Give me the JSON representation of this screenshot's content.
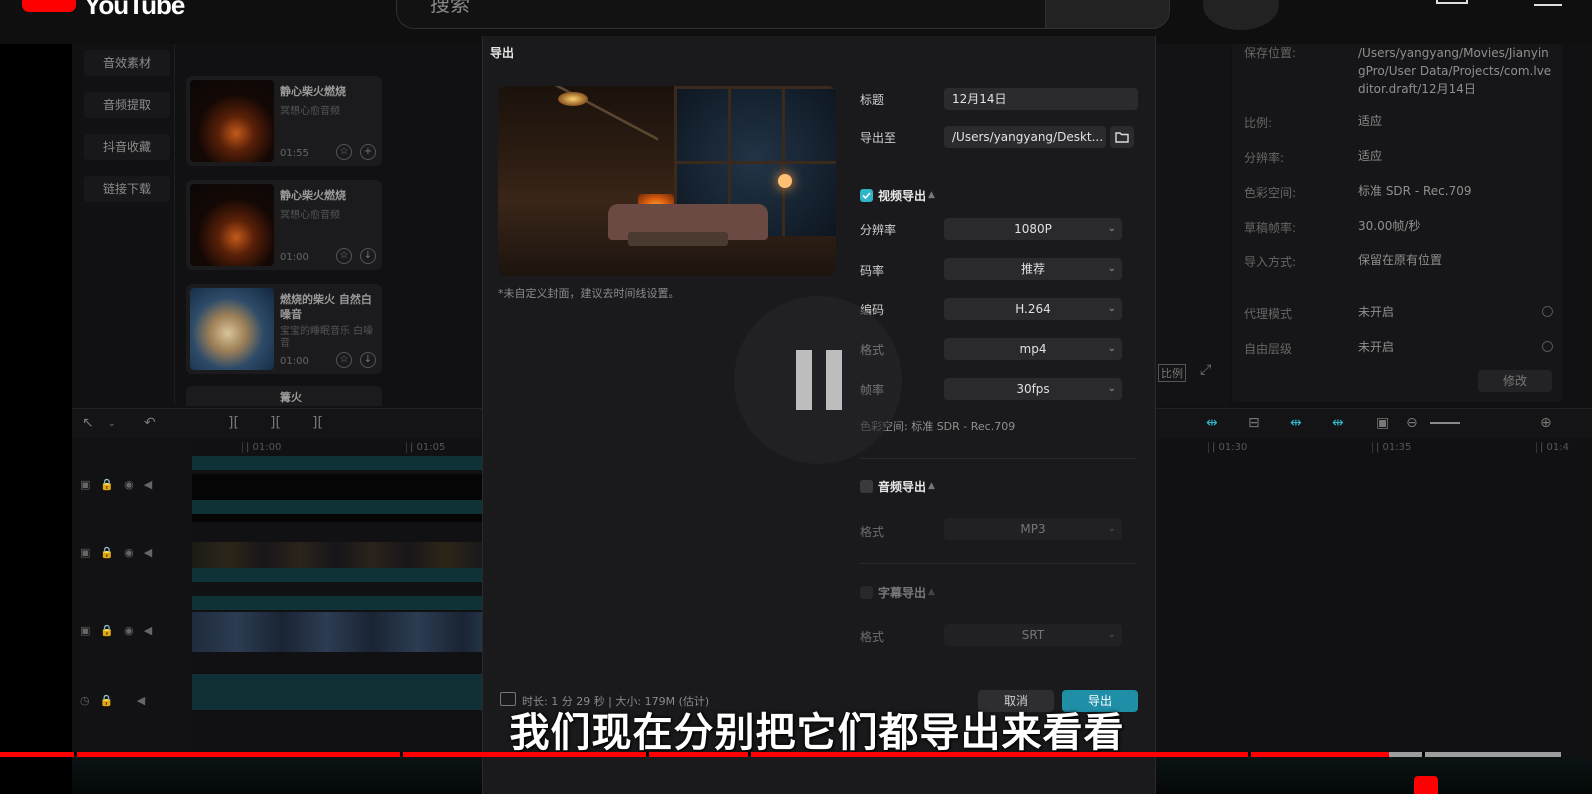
{
  "youtube": {
    "logo_text": "YouTube",
    "search_placeholder": "搜索"
  },
  "media_nav": {
    "items": [
      "音效素材",
      "音频提取",
      "抖音收藏",
      "链接下载"
    ]
  },
  "media_cards": [
    {
      "title": "静心柴火燃烧",
      "subtitle": "冥想心愈音频",
      "time": "01:55"
    },
    {
      "title": "静心柴火燃烧",
      "subtitle": "冥想心愈音频",
      "time": "01:00"
    },
    {
      "title": "燃烧的柴火 自然白噪音",
      "subtitle": "宝宝的睡眠音乐 白噪音",
      "time": "01:00"
    },
    {
      "title": "篝火"
    }
  ],
  "properties": {
    "rows": [
      {
        "label": "保存位置:",
        "value": "/Users/yangyang/Movies/JianyingPro/User Data/Projects/com.lveditor.draft/12月14日"
      },
      {
        "label": "比例:",
        "value": "适应"
      },
      {
        "label": "分辨率:",
        "value": "适应"
      },
      {
        "label": "色彩空间:",
        "value": "标准 SDR - Rec.709"
      },
      {
        "label": "草稿帧率:",
        "value": "30.00帧/秒"
      },
      {
        "label": "导入方式:",
        "value": "保留在原有位置"
      },
      {
        "label": "代理模式",
        "value": "未开启"
      },
      {
        "label": "自由层级",
        "value": "未开启"
      }
    ],
    "modify_button": "修改"
  },
  "player": {
    "ratio_label": "比例"
  },
  "timeline": {
    "ruler": [
      "| 01:00",
      "| 01:05",
      "| 01:30",
      "| 01:35",
      "| 01:4"
    ]
  },
  "export_dialog": {
    "title": "导出",
    "cover_note": "*未自定义封面，建议去时间线设置。",
    "title_label": "标题",
    "title_value": "12月14日",
    "export_to_label": "导出至",
    "export_to_value": "/Users/yangyang/Deskt...",
    "video_section": {
      "label": "视频导出",
      "checked": true,
      "resolution_label": "分辨率",
      "resolution_value": "1080P",
      "bitrate_label": "码率",
      "bitrate_value": "推荐",
      "codec_label": "编码",
      "codec_value": "H.264",
      "format_label": "格式",
      "format_value": "mp4",
      "fps_label": "帧率",
      "fps_value": "30fps",
      "color_space": "色彩空间:  标准 SDR - Rec.709"
    },
    "audio_section": {
      "label": "音频导出",
      "checked": false,
      "format_label": "格式",
      "format_value": "MP3"
    },
    "subtitle_section": {
      "label": "字幕导出",
      "format_label": "格式",
      "format_value": "SRT"
    },
    "footer_info": "时长: 1 分 29 秒 | 大小: 179M (估计)",
    "cancel_button": "取消",
    "export_button": "导出"
  },
  "caption": "我们现在分别把它们都导出来看看",
  "progress": {
    "played_fraction": 0.888,
    "loaded_fraction": 0.998
  },
  "colors": {
    "accent": "#2fb4c8",
    "youtube_red": "#ff0000",
    "export_button": "#1f8fa8"
  }
}
